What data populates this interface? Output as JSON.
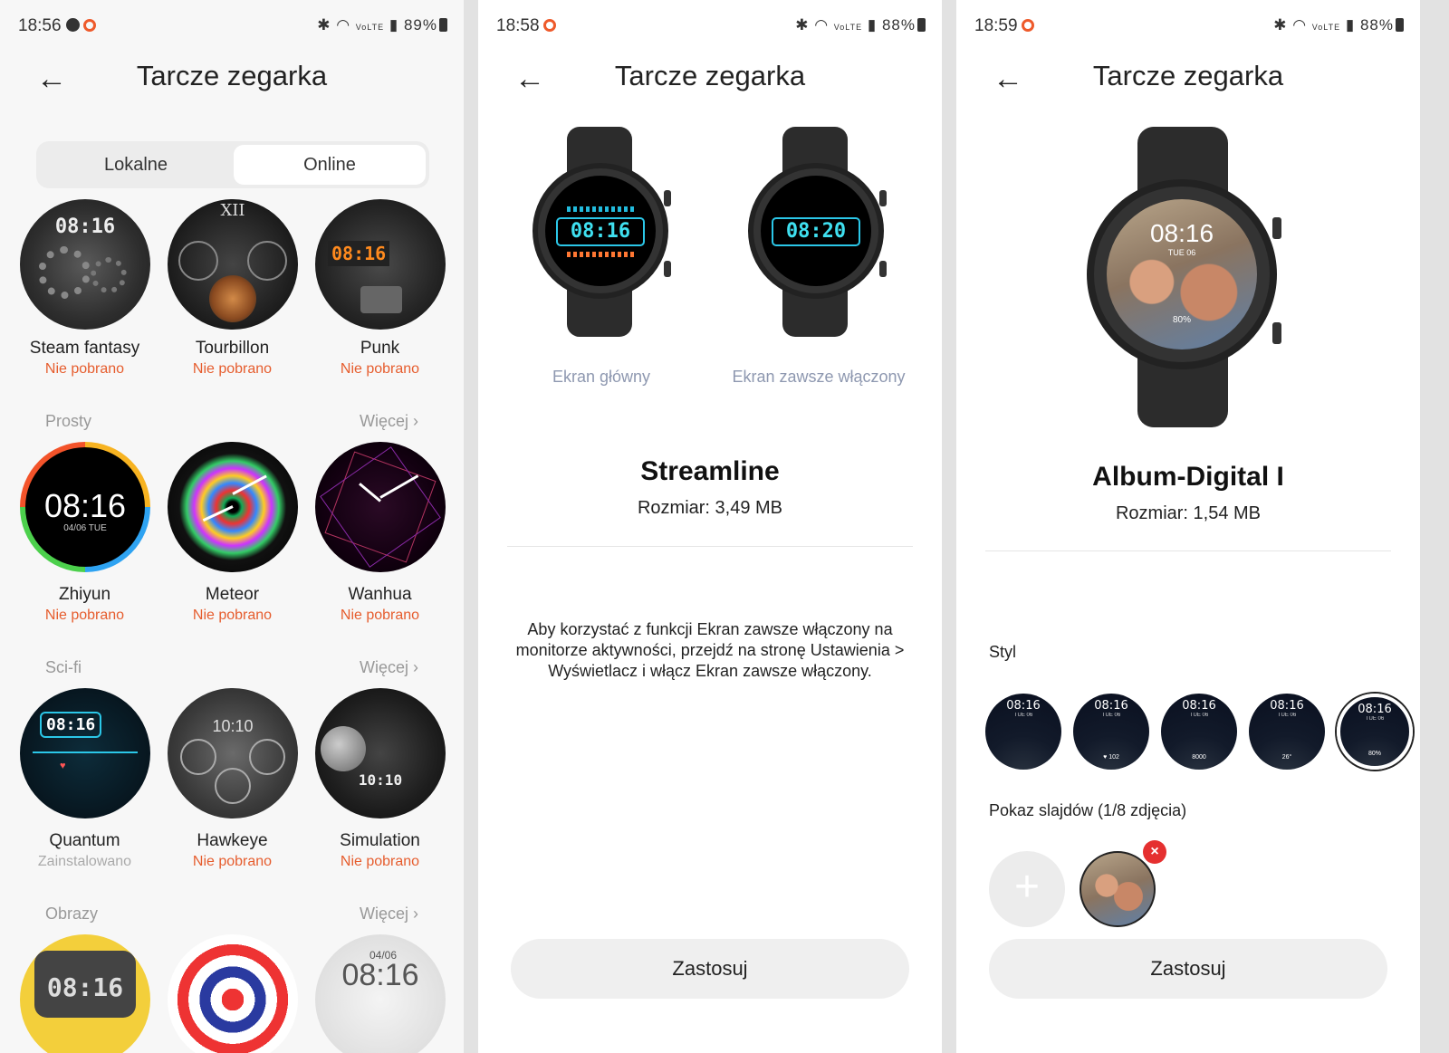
{
  "screens": [
    {
      "status": {
        "time": "18:56",
        "battery": "89%"
      },
      "header": {
        "title": "Tarcze zegarka"
      },
      "tabs": {
        "local": "Lokalne",
        "online": "Online",
        "active": "online"
      },
      "sections": {
        "prosty": {
          "title": "Prosty",
          "more": "Więcej"
        },
        "scifi": {
          "title": "Sci-fi",
          "more": "Więcej"
        },
        "obrazy": {
          "title": "Obrazy",
          "more": "Więcej"
        }
      },
      "faces": [
        {
          "name": "Steam fantasy",
          "status": "Nie pobrano",
          "time": "08:16"
        },
        {
          "name": "Tourbillon",
          "status": "Nie pobrano"
        },
        {
          "name": "Punk",
          "status": "Nie pobrano",
          "time": "08:16"
        },
        {
          "name": "Zhiyun",
          "status": "Nie pobrano",
          "time": "08:16",
          "date": "04/06 TUE"
        },
        {
          "name": "Meteor",
          "status": "Nie pobrano"
        },
        {
          "name": "Wanhua",
          "status": "Nie pobrano"
        },
        {
          "name": "Quantum",
          "status": "Zainstalowano",
          "time": "08:16"
        },
        {
          "name": "Hawkeye",
          "status": "Nie pobrano",
          "time": "10:10"
        },
        {
          "name": "Simulation",
          "status": "Nie pobrano",
          "time": "10:10"
        },
        {
          "time": "08:16"
        },
        {},
        {
          "time": "08:16",
          "date": "04/06"
        }
      ]
    },
    {
      "status": {
        "time": "18:58",
        "battery": "88%"
      },
      "header": {
        "title": "Tarcze zegarka"
      },
      "preview": {
        "main_time": "08:16",
        "aod_time": "08:20",
        "main_caption": "Ekran główny",
        "aod_caption": "Ekran zawsze włączony"
      },
      "name": "Streamline",
      "size": "Rozmiar: 3,49 MB",
      "note": "Aby korzystać z funkcji Ekran zawsze włączony na monitorze aktywności, przejdź na stronę Ustawienia > Wyświetlacz i włącz Ekran zawsze włączony.",
      "apply": "Zastosuj"
    },
    {
      "status": {
        "time": "18:59",
        "battery": "88%"
      },
      "header": {
        "title": "Tarcze zegarka"
      },
      "preview": {
        "time": "08:16",
        "date": "TUE 06",
        "battery": "80%"
      },
      "name": "Album-Digital I",
      "size": "Rozmiar: 1,54 MB",
      "style_label": "Styl",
      "styles": [
        {
          "time": "08:16",
          "date": "TUE 06",
          "sub": ""
        },
        {
          "time": "08:16",
          "date": "TUE 06",
          "sub": "♥ 102"
        },
        {
          "time": "08:16",
          "date": "TUE 06",
          "sub": "8000"
        },
        {
          "time": "08:16",
          "date": "TUE 06",
          "sub": "26°"
        },
        {
          "time": "08:16",
          "date": "TUE 06",
          "sub": "80%"
        }
      ],
      "slideshow_label": "Pokaz slajdów (1/8 zdjęcia)",
      "apply": "Zastosuj"
    }
  ]
}
